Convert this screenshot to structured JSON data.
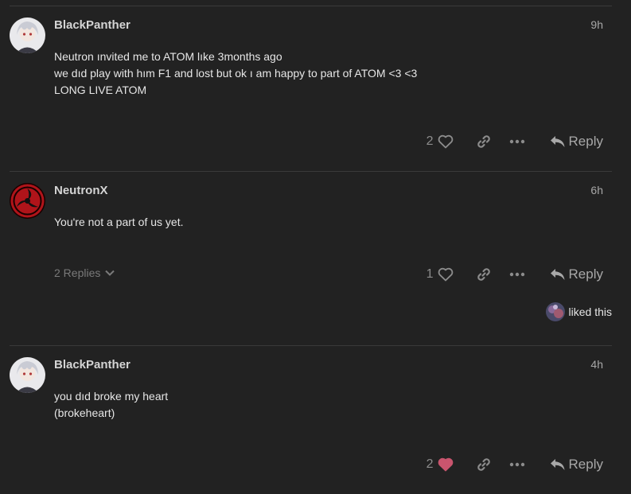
{
  "posts": [
    {
      "username": "BlackPanther",
      "time": "9h",
      "body": "Neutron ınvited me to ATOM lıke 3months ago\nwe dıd play with hım F1 and lost but ok ı am happy to part of ATOM <3 <3\nLONG LIVE ATOM",
      "likes": "2",
      "liked": false,
      "reply_label": "Reply"
    },
    {
      "username": "NeutronX",
      "time": "6h",
      "body": "You're not a part of us yet.",
      "likes": "1",
      "liked": false,
      "replies_label": "2 Replies",
      "reply_label": "Reply",
      "liked_this_label": "liked this"
    },
    {
      "username": "BlackPanther",
      "time": "4h",
      "body": "you dıd broke my heart\n(brokeheart)",
      "likes": "2",
      "liked": true,
      "reply_label": "Reply"
    }
  ],
  "colors": {
    "background": "#222222",
    "liked_heart": "#c9556e",
    "muted": "#8c8c8c"
  }
}
